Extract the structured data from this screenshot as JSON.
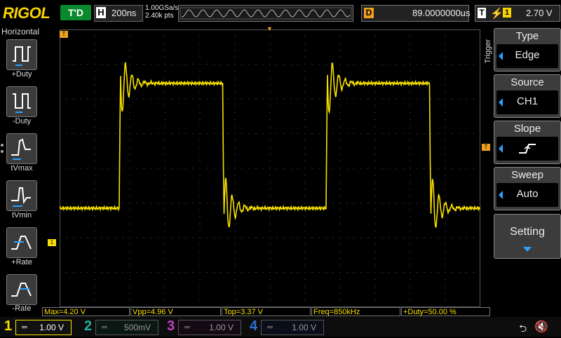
{
  "brand": "RIGOL",
  "status": {
    "trigger_state": "T'D",
    "horizontal_tag": "H",
    "timebase": "200ns",
    "sample_rate": "1.00GSa/s",
    "memory_depth": "2.40k pts",
    "delay_tag": "D",
    "delay": "89.0000000us",
    "trigger_tag": "T",
    "trigger_source_tag": "1",
    "trigger_level": "2.70 V"
  },
  "left_menu": {
    "title": "Horizontal",
    "items": [
      {
        "label": "+Duty",
        "icon": "pos-duty-icon"
      },
      {
        "label": "-Duty",
        "icon": "neg-duty-icon"
      },
      {
        "label": "tVmax",
        "icon": "tvmax-icon"
      },
      {
        "label": "tVmin",
        "icon": "tvmin-icon"
      },
      {
        "label": "+Rate",
        "icon": "pos-rate-icon"
      },
      {
        "label": "-Rate",
        "icon": "neg-rate-icon"
      }
    ]
  },
  "markers": {
    "channel1_ground": "1",
    "trigger_level": "T",
    "trigger_position": "T"
  },
  "measurements": [
    {
      "label": "Max=4.20 V"
    },
    {
      "label": "Vpp=4.96 V"
    },
    {
      "label": "Top=3.37 V"
    },
    {
      "label": "Freq=850kHz"
    },
    {
      "label": "+Duty=50.00 %"
    }
  ],
  "trigger_menu": {
    "title": "Trigger",
    "items": [
      {
        "title": "Type",
        "value": "Edge"
      },
      {
        "title": "Source",
        "value": "CH1"
      },
      {
        "title": "Slope",
        "value": ""
      },
      {
        "title": "Sweep",
        "value": "Auto"
      }
    ],
    "setting_label": "Setting"
  },
  "channels": [
    {
      "number": "1",
      "value": "1.00 V",
      "color": "#f7e000",
      "active": true
    },
    {
      "number": "2",
      "value": "500mV",
      "color": "#1fb39a",
      "active": false
    },
    {
      "number": "3",
      "value": "1.00 V",
      "color": "#c040c0",
      "active": false
    },
    {
      "number": "4",
      "value": "1.00 V",
      "color": "#3070d0",
      "active": false
    }
  ],
  "colors": {
    "ch1": "#f7e000",
    "trigger_marker": "#f0a020",
    "accent_blue": "#2aa0ff",
    "trig_state_bg": "#0a8a2e"
  },
  "waveform": {
    "type": "square",
    "low_level_div": -1.15,
    "high_level_div": 2.45,
    "period_div": 5.9,
    "first_rise_div": 1.7,
    "duty": 0.5
  }
}
